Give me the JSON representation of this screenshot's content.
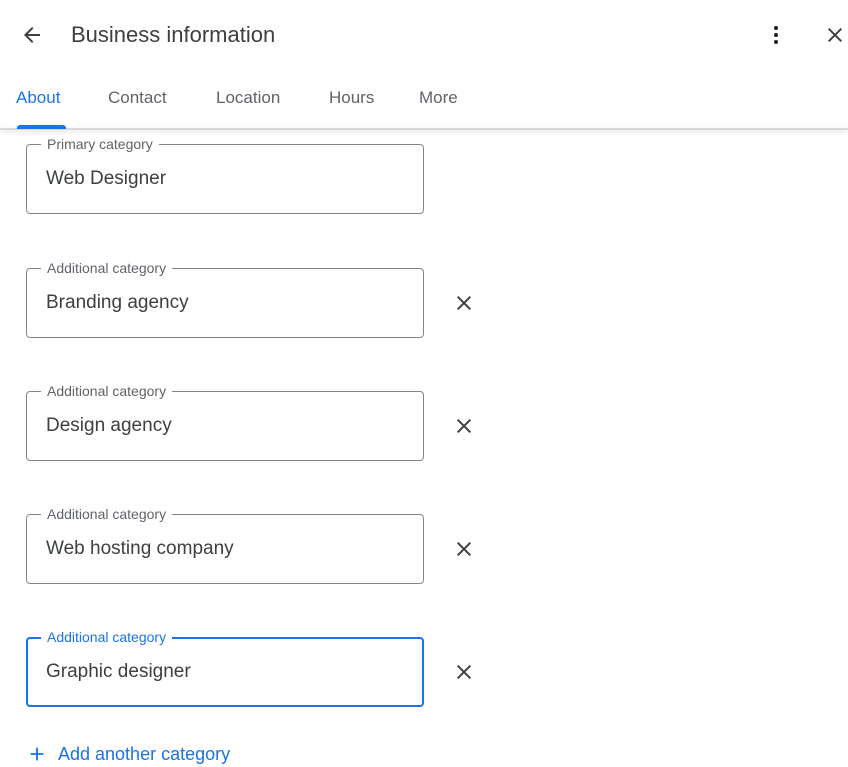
{
  "header": {
    "title": "Business information",
    "back_icon": "arrow-left-icon",
    "more_icon": "more-vert-icon",
    "close_icon": "close-icon"
  },
  "tabs": [
    {
      "label": "About",
      "active": true
    },
    {
      "label": "Contact",
      "active": false
    },
    {
      "label": "Location",
      "active": false
    },
    {
      "label": "Hours",
      "active": false
    },
    {
      "label": "More",
      "active": false
    }
  ],
  "categories": {
    "primary": {
      "label": "Primary category",
      "value": "Web Designer"
    },
    "additional": [
      {
        "label": "Additional category",
        "value": "Branding agency"
      },
      {
        "label": "Additional category",
        "value": "Design agency"
      },
      {
        "label": "Additional category",
        "value": "Web hosting company"
      },
      {
        "label": "Additional category",
        "value": "Graphic designer",
        "focused": true
      }
    ],
    "add_label": "Add another category"
  },
  "colors": {
    "accent": "#1a73e8",
    "text": "#3c4043",
    "secondary_text": "#5f6368",
    "border": "#80868b"
  }
}
